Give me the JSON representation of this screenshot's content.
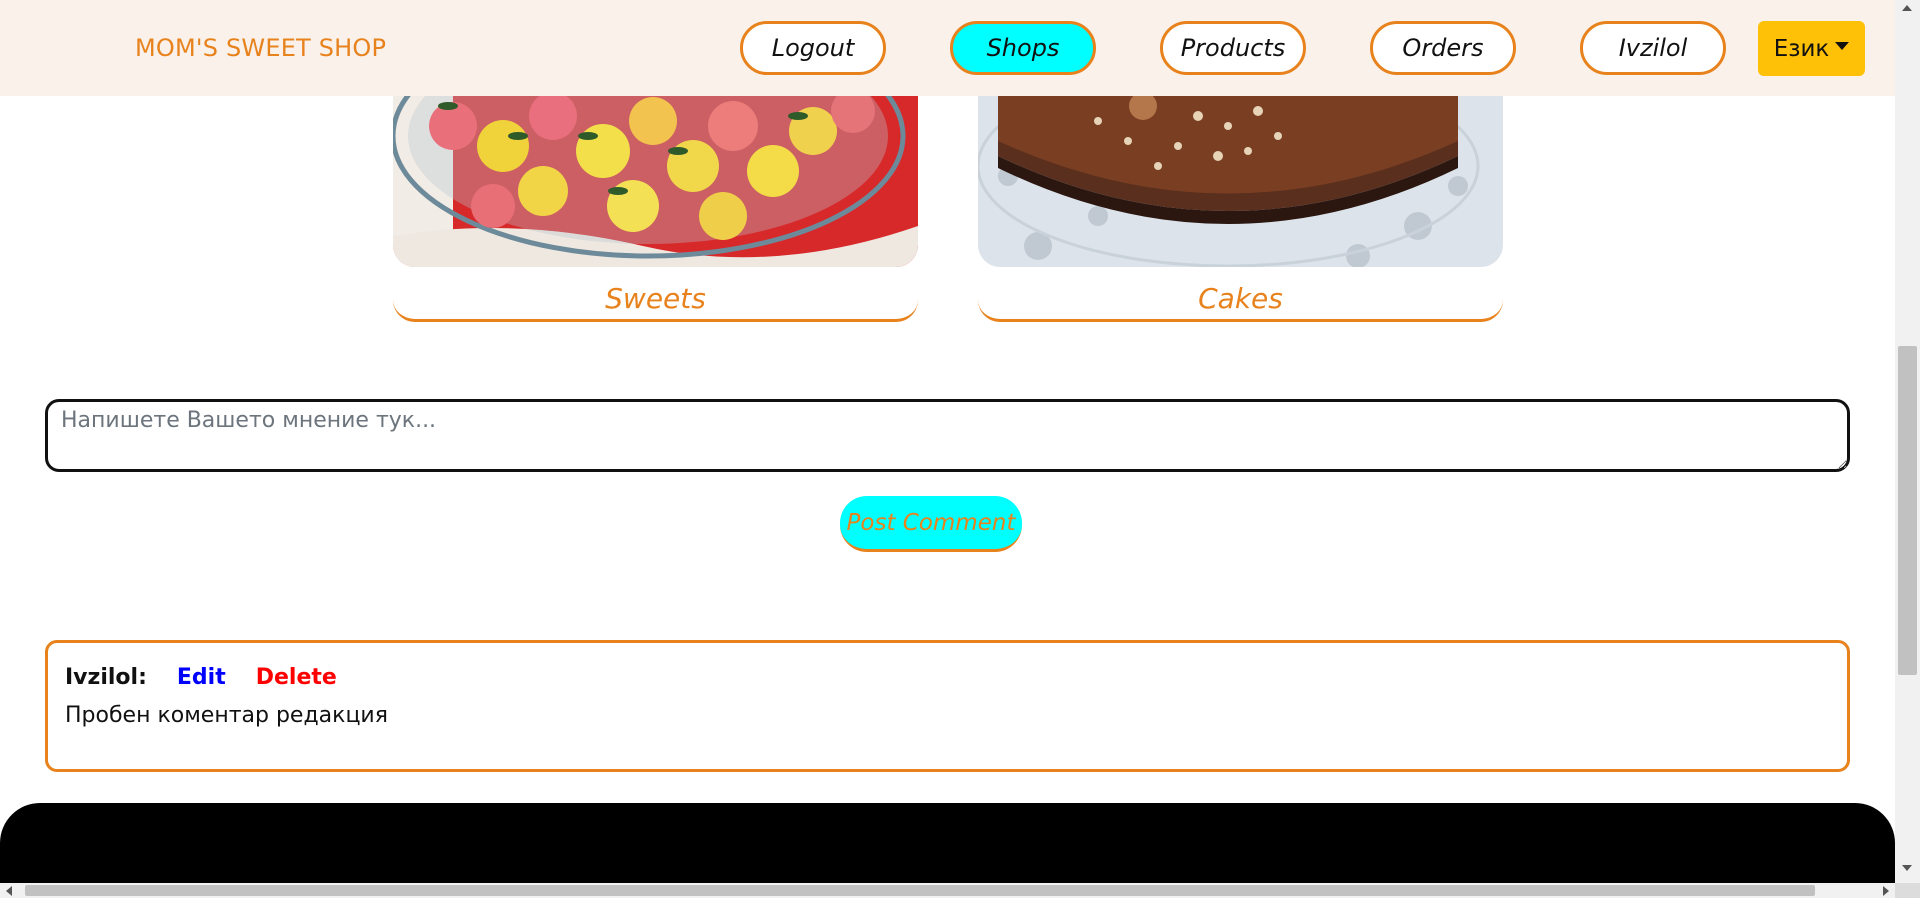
{
  "navbar": {
    "brand": "MOM'S SWEET SHOP",
    "items": [
      {
        "label": "Logout",
        "active": false
      },
      {
        "label": "Shops",
        "active": true
      },
      {
        "label": "Products",
        "active": false
      },
      {
        "label": "Orders",
        "active": false
      },
      {
        "label": "Ivzilol",
        "active": false
      }
    ],
    "language_label": "Език"
  },
  "categories": [
    {
      "label": "Sweets"
    },
    {
      "label": "Cakes"
    }
  ],
  "comment_form": {
    "placeholder": "Напишете Вашето мнение тук...",
    "value": "",
    "submit_label": "Post Comment"
  },
  "comments": [
    {
      "author": "Ivzilol:",
      "edit_label": "Edit",
      "delete_label": "Delete",
      "text": "Пробен коментар редакция"
    }
  ],
  "colors": {
    "accent": "#e8821c",
    "active_nav": "#00ffff",
    "language_button": "#ffc107",
    "navbar_bg": "#f9f1ea",
    "edit_link": "#0000ff",
    "delete_link": "#ff0000",
    "footer": "#000000"
  }
}
